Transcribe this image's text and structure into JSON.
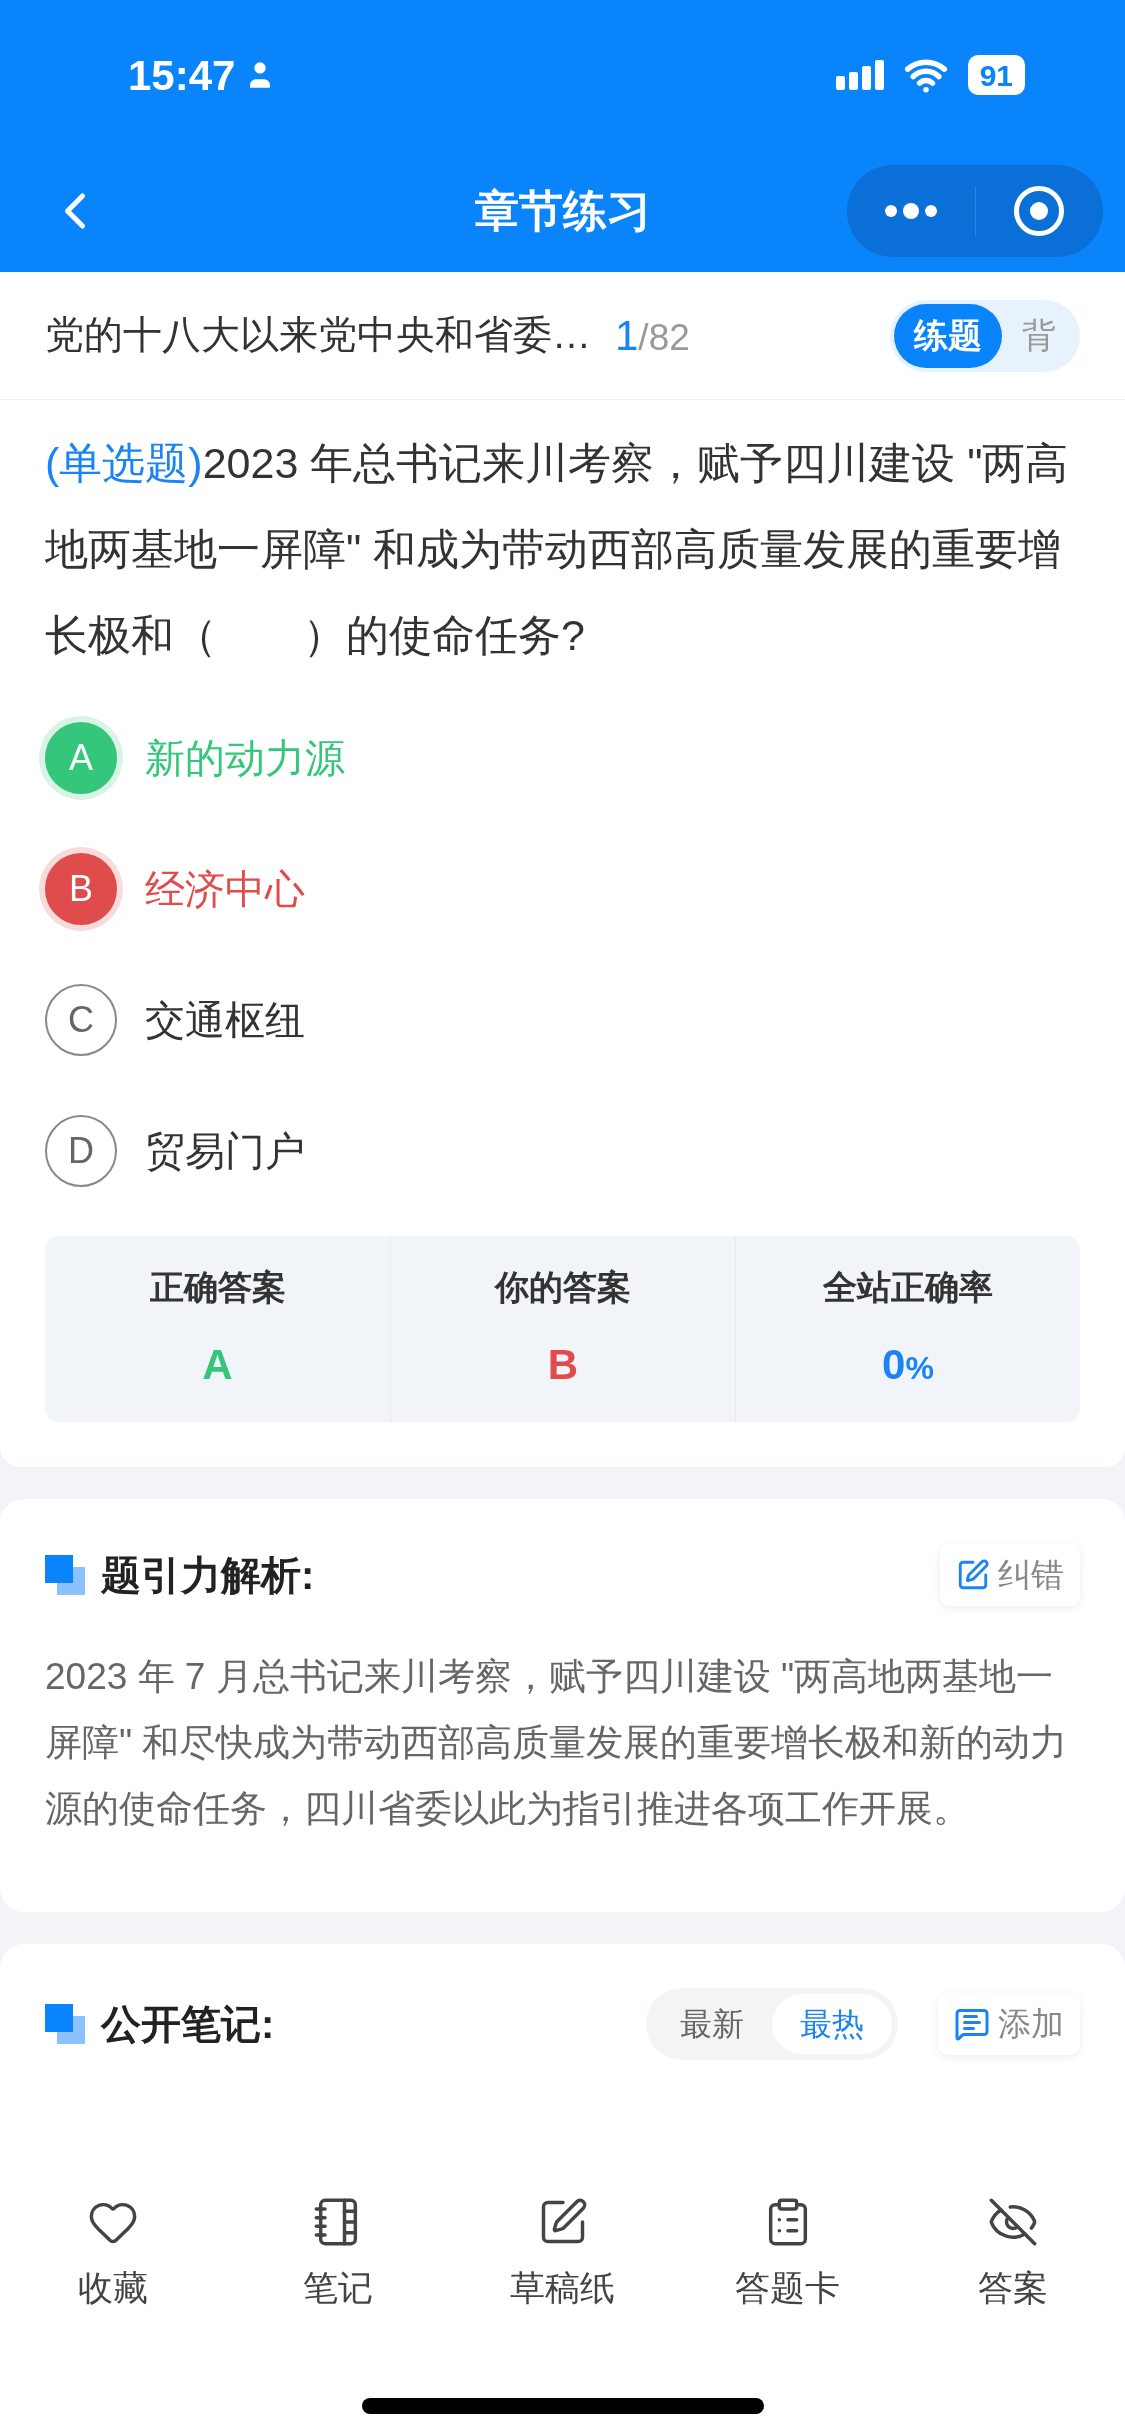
{
  "status_bar": {
    "time": "15:47",
    "battery": "91"
  },
  "nav": {
    "title": "章节练习"
  },
  "chapter": {
    "title": "党的十八大以来党中央和省委…",
    "current": "1",
    "total": "/82",
    "modes": [
      {
        "label": "练题",
        "selected": true
      },
      {
        "label": "背",
        "selected": false
      }
    ]
  },
  "question": {
    "type": "(单选题)",
    "text": "2023 年总书记来川考察，赋予四川建设 \"两高地两基地一屏障\" 和成为带动西部高质量发展的重要增长极和（　　）的使命任务?"
  },
  "options": [
    {
      "letter": "A",
      "text": "新的动力源",
      "kind": "correct"
    },
    {
      "letter": "B",
      "text": "经济中心",
      "kind": "wrong"
    },
    {
      "letter": "C",
      "text": "交通枢纽",
      "kind": "plain"
    },
    {
      "letter": "D",
      "text": "贸易门户",
      "kind": "plain"
    }
  ],
  "stats": [
    {
      "label": "正确答案",
      "value": "A",
      "kind": "correct"
    },
    {
      "label": "你的答案",
      "value": "B",
      "kind": "wrong"
    },
    {
      "label": "全站正确率",
      "value": "0",
      "unit": "%",
      "kind": "rate"
    }
  ],
  "analysis": {
    "title": "题引力解析:",
    "button": "纠错",
    "text": "2023 年 7 月总书记来川考察，赋予四川建设 \"两高地两基地一屏障\" 和尽快成为带动西部高质量发展的重要增长极和新的动力源的使命任务，四川省委以此为指引推进各项工作开展。"
  },
  "notes": {
    "title": "公开笔记:",
    "sorts": [
      {
        "label": "最新",
        "selected": false
      },
      {
        "label": "最热",
        "selected": true
      }
    ],
    "button": "添加"
  },
  "toolbar": [
    {
      "label": "收藏",
      "kind": "favorite"
    },
    {
      "label": "笔记",
      "kind": "notes"
    },
    {
      "label": "草稿纸",
      "kind": "draft"
    },
    {
      "label": "答题卡",
      "kind": "sheet"
    },
    {
      "label": "答案",
      "kind": "answer"
    }
  ]
}
